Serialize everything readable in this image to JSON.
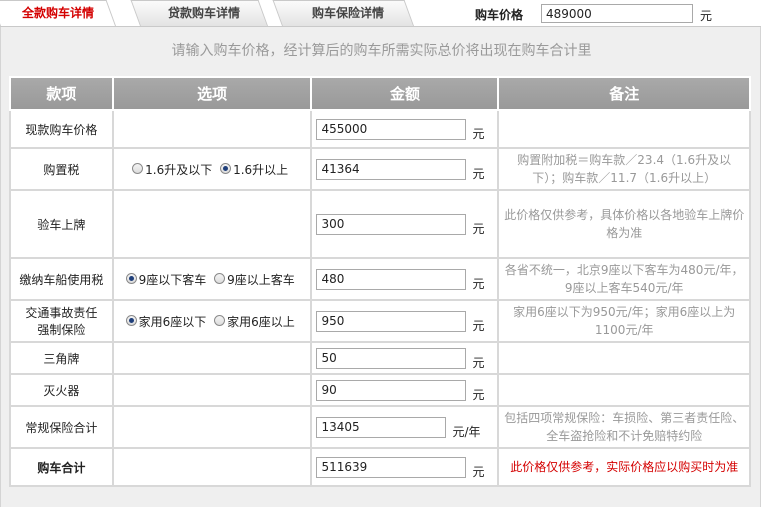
{
  "tabs": [
    {
      "label": "全款购车详情",
      "active": true
    },
    {
      "label": "贷款购车详情",
      "active": false
    },
    {
      "label": "购车保险详情",
      "active": false
    }
  ],
  "price": {
    "label": "购车价格",
    "value": "489000",
    "unit": "元"
  },
  "hint": "请输入购车价格，经计算后的购车所需实际总价将出现在购车合计里",
  "table": {
    "headers": [
      "款项",
      "选项",
      "金额",
      "备注"
    ],
    "rows": [
      {
        "name": "现款购车价格",
        "amount": "455000",
        "unit": "元",
        "note": ""
      },
      {
        "name": "购置税",
        "options": [
          {
            "label": "1.6升及以下",
            "selected": false
          },
          {
            "label": "1.6升以上",
            "selected": true
          }
        ],
        "amount": "41364",
        "unit": "元",
        "note": "购置附加税＝购车款／23.4（1.6升及以下）；购车款／11.7（1.6升以上）"
      },
      {
        "name": "验车上牌",
        "amount": "300",
        "unit": "元",
        "note": "此价格仅供参考，具体价格以各地验车上牌价格为准"
      },
      {
        "name": "缴纳车船使用税",
        "options": [
          {
            "label": "9座以下客车",
            "selected": true
          },
          {
            "label": "9座以上客车",
            "selected": false
          }
        ],
        "amount": "480",
        "unit": "元",
        "note": "各省不统一，北京9座以下客车为480元/年，9座以上客车540元/年"
      },
      {
        "name1": "交通事故责任",
        "name2": "强制保险",
        "options": [
          {
            "label": "家用6座以下",
            "selected": true
          },
          {
            "label": "家用6座以上",
            "selected": false
          }
        ],
        "amount": "950",
        "unit": "元",
        "note": "家用6座以下为950元/年；家用6座以上为1100元/年"
      },
      {
        "name": "三角牌",
        "amount": "50",
        "unit": "元",
        "note": ""
      },
      {
        "name": "灭火器",
        "amount": "90",
        "unit": "元",
        "note": ""
      },
      {
        "name": "常规保险合计",
        "amount": "13405",
        "unit": "元/年",
        "note": "包括四项常规保险：车损险、第三者责任险、全车盗抢险和不计免赔特约险"
      },
      {
        "name": "购车合计",
        "amount": "511639",
        "unit": "元",
        "note": "此价格仅供参考，实际价格应以购买时为准"
      }
    ]
  }
}
